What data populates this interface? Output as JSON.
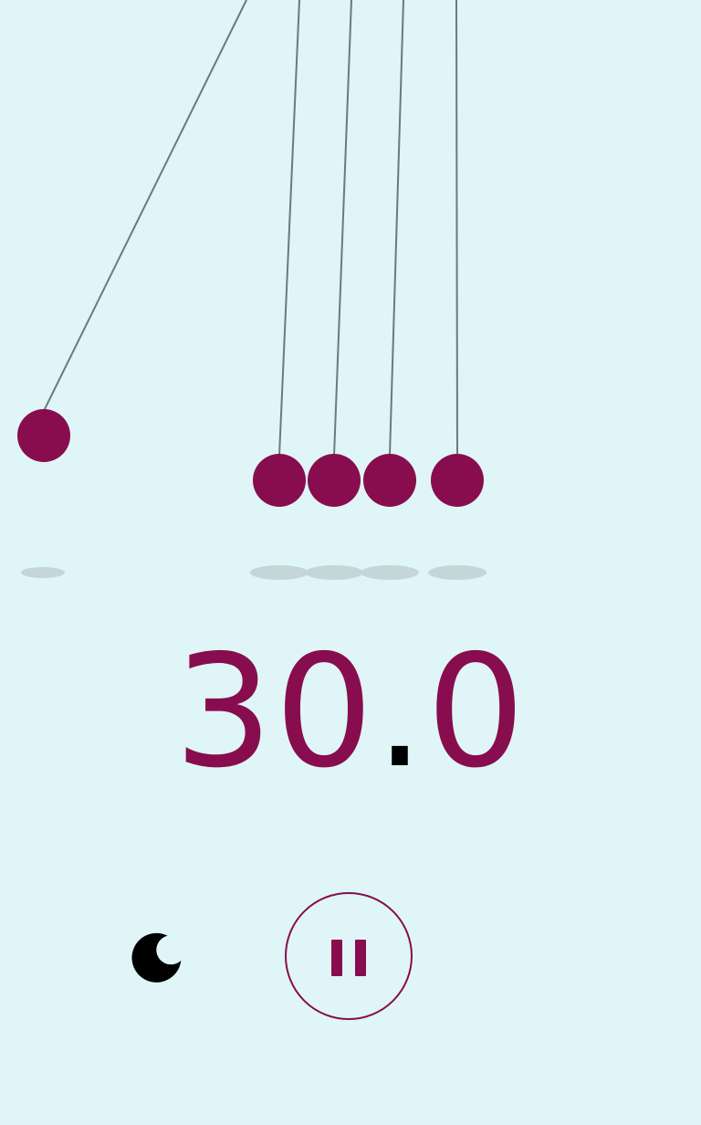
{
  "colors": {
    "background": "#dff5f7",
    "accent": "#880d4e",
    "string": "#6b7a7d",
    "shadow": "#c4d6d8",
    "dot": "#000000"
  },
  "timer": {
    "whole": "30",
    "decimal_point": ".",
    "fraction": "0"
  },
  "controls": {
    "theme_icon": "moon-icon",
    "pause_icon": "pause-icon"
  }
}
